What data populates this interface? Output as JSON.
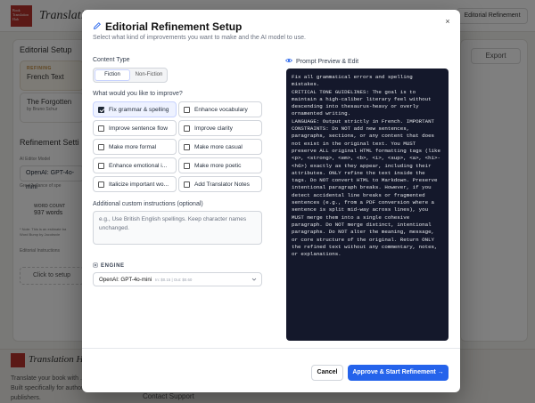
{
  "background": {
    "brand": "Translation",
    "logo_text": "Book Translation Hub",
    "top_button": "Editorial Refinement",
    "editorial_setup_title": "Editorial Setup",
    "card1_tag": "REFINING",
    "card1_text": "French Text",
    "card2_text": "The Forgotten",
    "card2_sub": "by Bruno Schur",
    "refinement_settings_title": "Refinement Setti",
    "ai_editor_label": "AI Editor Model",
    "ai_editor_value": "OpenAI: GPT-4o-mini",
    "ai_editor_desc": "Great balance of spe",
    "word_count_label": "WORD COUNT",
    "word_count_value": "937 words",
    "note_line1": "* Note: This is an estimate ba",
    "note_line2": "Word Bump by Jacobsvie",
    "editorial_instructions_label": "Editorial Instructions",
    "click_setup": "Click to setup",
    "export_label": "Export",
    "footer_brand": "Translation Hub",
    "footer_text": "Translate your book with ... Built specifically for author publishers.",
    "contact_support": "Contact Support"
  },
  "modal": {
    "title": "Editorial Refinement Setup",
    "subtitle": "Select what kind of improvements you want to make and the AI model to use.",
    "close_label": "×",
    "content_type_label": "Content Type",
    "content_types": [
      {
        "label": "Fiction",
        "active": true
      },
      {
        "label": "Non-Fiction",
        "active": false
      }
    ],
    "improve_label": "What would you like to improve?",
    "options": [
      {
        "label": "Fix grammar & spelling",
        "checked": true
      },
      {
        "label": "Enhance vocabulary",
        "checked": false
      },
      {
        "label": "Improve sentence flow",
        "checked": false
      },
      {
        "label": "Improve clarity",
        "checked": false
      },
      {
        "label": "Make more formal",
        "checked": false
      },
      {
        "label": "Make more casual",
        "checked": false
      },
      {
        "label": "Enhance emotional i...",
        "checked": false
      },
      {
        "label": "Make more poetic",
        "checked": false
      },
      {
        "label": "Italicize important wo...",
        "checked": false
      },
      {
        "label": "Add Translator Notes",
        "checked": false
      }
    ],
    "custom_label": "Additional custom instructions (optional)",
    "custom_placeholder": "e.g., Use British English spellings. Keep character names unchanged.",
    "engine_label": "ENGINE",
    "engine_value": "OpenAI: GPT-4o-mini",
    "engine_price": "In: $0.15 | Out: $0.60",
    "preview_label": "Prompt Preview & Edit",
    "preview_text": "Fix all grammatical errors and spelling mistakes.\nCRITICAL TONE GUIDELINES: The goal is to maintain a high-caliber literary feel without descending into thesaurus-heavy or overly ornamented writing.\nLANGUAGE: Output strictly in French. IMPORTANT CONSTRAINTS: Do NOT add new sentences, paragraphs, sections, or any content that does not exist in the original text. You MUST preserve ALL original HTML formatting tags (like <p>, <strong>, <em>, <b>, <i>, <sup>, <a>, <h1>-<h6>) exactly as they appear, including their attributes. ONLY refine the text inside the tags. Do NOT convert HTML to Markdown. Preserve intentional paragraph breaks. However, if you detect accidental line breaks or fragmented sentences (e.g., from a PDF conversion where a sentence is split mid-way across lines), you MUST merge them into a single cohesive paragraph. Do NOT merge distinct, intentional paragraphs. Do NOT alter the meaning, message, or core structure of the original. Return ONLY the refined text without any commentary, notes, or explanations.",
    "cancel_label": "Cancel",
    "approve_label": "Approve & Start Refinement →"
  },
  "colors": {
    "primary": "#2563eb",
    "brand_red": "#b7322c",
    "preview_bg": "#14182b"
  }
}
